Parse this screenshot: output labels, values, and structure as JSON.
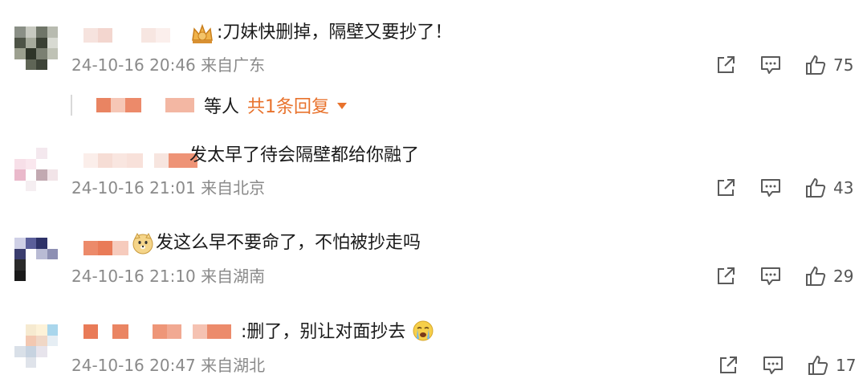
{
  "comments": [
    {
      "text": ":刀妹快删掉，隔壁又要抄了！",
      "date": "24-10-16 20:46",
      "location": "来自广东",
      "likes": "75",
      "emoji": "crown-badge-icon"
    },
    {
      "text": "发太早了待会隔壁都给你融了",
      "date": "24-10-16 21:01",
      "location": "来自北京",
      "likes": "43"
    },
    {
      "text": "发这么早不要命了，不怕被抄走吗",
      "date": "24-10-16 21:10",
      "location": "来自湖南",
      "likes": "29",
      "emoji": "doge-face-icon"
    },
    {
      "text": ":删了，别让对面抄去",
      "date": "24-10-16 20:47",
      "location": "来自湖北",
      "likes": "17",
      "emoji": "crying-face-icon"
    }
  ],
  "reply": {
    "label": "等人",
    "link": "共1条回复"
  },
  "colors": {
    "accent": "#e8722c",
    "meta_text": "#8a8a8a",
    "icon": "#5a5a5a"
  }
}
